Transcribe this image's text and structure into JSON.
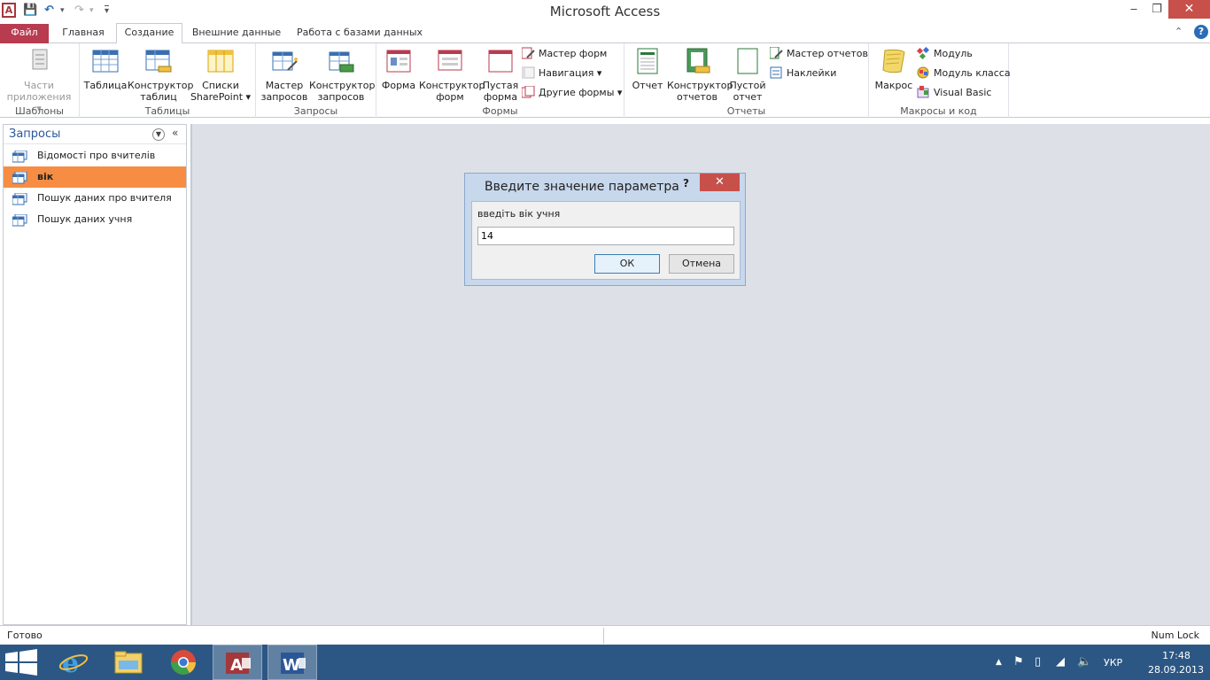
{
  "titlebar": {
    "app_icon_letter": "A",
    "title": "Microsoft Access",
    "minimize": "‒",
    "maximize": "❐",
    "close": "✕"
  },
  "quick_access": {
    "save": "💾",
    "undo": "↶",
    "undo_drop": "▾",
    "redo": "↷",
    "redo_drop": "▾",
    "customize": "▾"
  },
  "tabs": {
    "file": "Файл",
    "home": "Главная",
    "create": "Создание",
    "external": "Внешние данные",
    "database": "Работа с базами данных"
  },
  "ribbon": {
    "templates": {
      "label": "Шаблоны",
      "app_parts": "Части приложения ▾"
    },
    "tables": {
      "label": "Таблицы",
      "table": "Таблица",
      "table_design": "Конструктор таблиц",
      "sharepoint": "Списки SharePoint ▾"
    },
    "queries": {
      "label": "Запросы",
      "query_wizard": "Мастер запросов",
      "query_design": "Конструктор запросов"
    },
    "forms": {
      "label": "Формы",
      "form": "Форма",
      "form_design": "Конструктор форм",
      "blank_form": "Пустая форма",
      "form_wizard": "Мастер форм",
      "navigation": "Навигация ▾",
      "more_forms": "Другие формы ▾"
    },
    "reports": {
      "label": "Отчеты",
      "report": "Отчет",
      "report_design": "Конструктор отчетов",
      "blank_report": "Пустой отчет",
      "report_wizard": "Мастер отчетов",
      "labels": "Наклейки"
    },
    "macros": {
      "label": "Макросы и код",
      "macro": "Макрос",
      "module": "Модуль",
      "class_module": "Модуль класса",
      "visual_basic": "Visual Basic"
    }
  },
  "nav_pane": {
    "title": "Запросы",
    "items": [
      {
        "label": "Відомості про вчителів"
      },
      {
        "label": "вік"
      },
      {
        "label": "Пошук даних про вчителя"
      },
      {
        "label": "Пошук даних учня"
      }
    ]
  },
  "dialog": {
    "title": "Введите значение параметра",
    "help": "?",
    "close": "✕",
    "prompt": "введіть вік учня",
    "value": "14",
    "ok": "ОК",
    "cancel": "Отмена"
  },
  "status": {
    "left": "Готово",
    "right": "Num Lock"
  },
  "taskbar": {
    "lang": "УКР",
    "time": "17:48",
    "date": "28.09.2013"
  },
  "colors": {
    "file_tab": "#b83b4f",
    "selected_nav": "#f68d43",
    "taskbar": "#2c5784",
    "dialog_frame": "#c7d7ec",
    "close_button": "#c7504b"
  }
}
